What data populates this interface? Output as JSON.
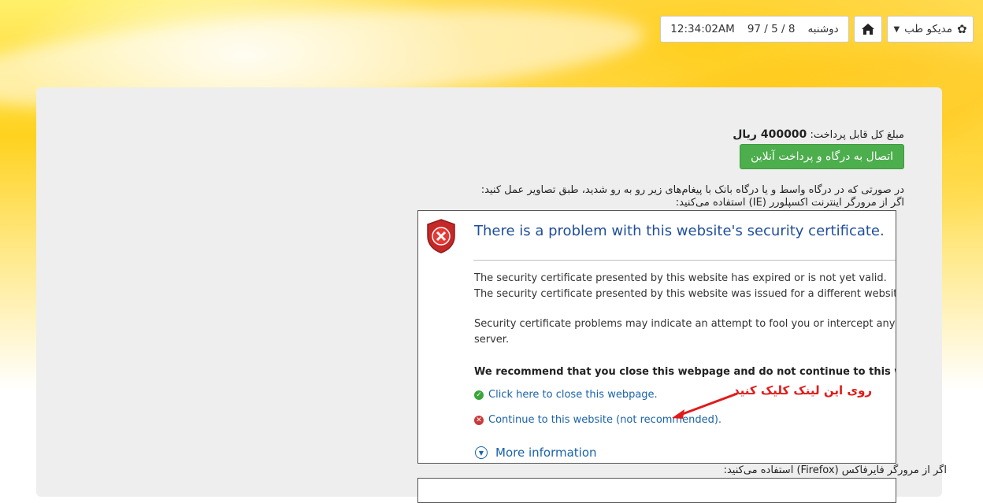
{
  "topbar": {
    "menu_label": "مدیکو طب",
    "menu_icon": "gear-icon",
    "home_icon": "home-icon",
    "day": "دوشنبه",
    "date": "8 / 5 / 97",
    "time": "12:34:02AM"
  },
  "payment": {
    "amount_label": "مبلغ کل قابل پرداخت:",
    "amount_value": "400000 ریال",
    "pay_button": "اتصال به درگاه و پرداخت آنلاین"
  },
  "instructions": {
    "line1": "در صورتی که در درگاه واسط و یا درگاه بانک با پیغام‌های زیر رو به رو شدید، طبق تصاویر عمل کنید:",
    "ie_label": "اگر از مرورگر اینترنت اکسپلورر (IE) استفاده می‌کنید:",
    "firefox_label": "اگر از مرورگر فایرفاکس (Firefox) استفاده می‌کنید:"
  },
  "ie_screenshot": {
    "title": "There is a problem with this website's security certificate.",
    "line1": "The security certificate presented by this website has expired or is not yet valid.",
    "line2": "The security certificate presented by this website was issued for a different website's",
    "line3": "Security certificate problems may indicate an attempt to fool you or intercept any d",
    "line4": "server.",
    "recommend": "We recommend that you close this webpage and do not continue to this webs",
    "close_link": "Click here to close this webpage.",
    "continue_link": "Continue to this website (not recommended).",
    "more_info": "More information",
    "annotation": "روی این لینک کلیک کنید"
  }
}
